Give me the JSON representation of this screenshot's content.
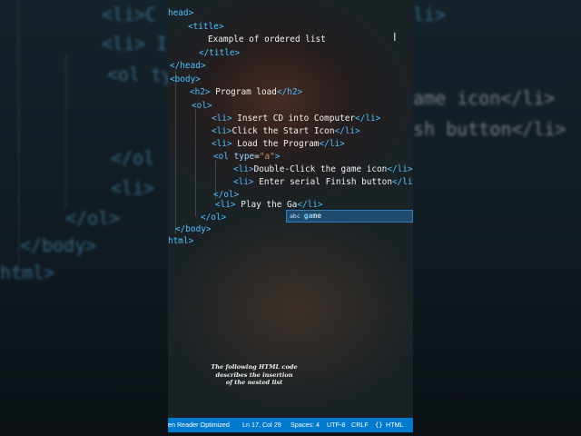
{
  "background": {
    "left_lines": [
      "<li>C",
      "<li> I",
      "<ol ty",
      "</ol",
      "<li>",
      "</ol>",
      "</body>",
      "html>"
    ],
    "right_lines": [
      "li>",
      "ame icon</li>",
      "sh button</li>"
    ]
  },
  "code_lines": [
    [
      "head>"
    ],
    [
      "<title>"
    ],
    [
      "Example of ordered list"
    ],
    [
      "</title>"
    ],
    [
      "</head>"
    ],
    [
      "<body>"
    ],
    [
      "<h2>",
      " Program load",
      "</h2>"
    ],
    [
      "<ol>"
    ],
    [
      "<li>",
      " Insert CD into Computer",
      "</li>"
    ],
    [
      "<li>",
      "Click the Start Icon",
      "</li>"
    ],
    [
      "<li>",
      " Load the Program",
      "</li>"
    ],
    [
      "<ol ",
      "type",
      "=",
      "\"a\"",
      ">"
    ],
    [
      "<li>",
      "Double-Click the game icon",
      "</li>"
    ],
    [
      "<li>",
      " Enter serial Finish button",
      "</li>"
    ],
    [
      "</ol>"
    ],
    [
      "<li>",
      " Play the Ga",
      "</li>"
    ],
    [
      "</ol>"
    ],
    [
      "</body>"
    ],
    [
      "html>"
    ]
  ],
  "suggestion": {
    "icon": "abc",
    "match": "ga",
    "rest": "me"
  },
  "caption": [
    "The following HTML code",
    "describes the insertion",
    "of the nested list"
  ],
  "status_bar": {
    "screen_reader": "een Reader Optimized",
    "position": "Ln 17, Col 29",
    "spaces": "Spaces: 4",
    "encoding": "UTF-8",
    "eol": "CRLF",
    "language_icon": "braces-icon",
    "language": "HTML"
  },
  "colors": {
    "tag": "#4fc1ff",
    "string": "#ce9178",
    "status_bar": "#007acc"
  }
}
